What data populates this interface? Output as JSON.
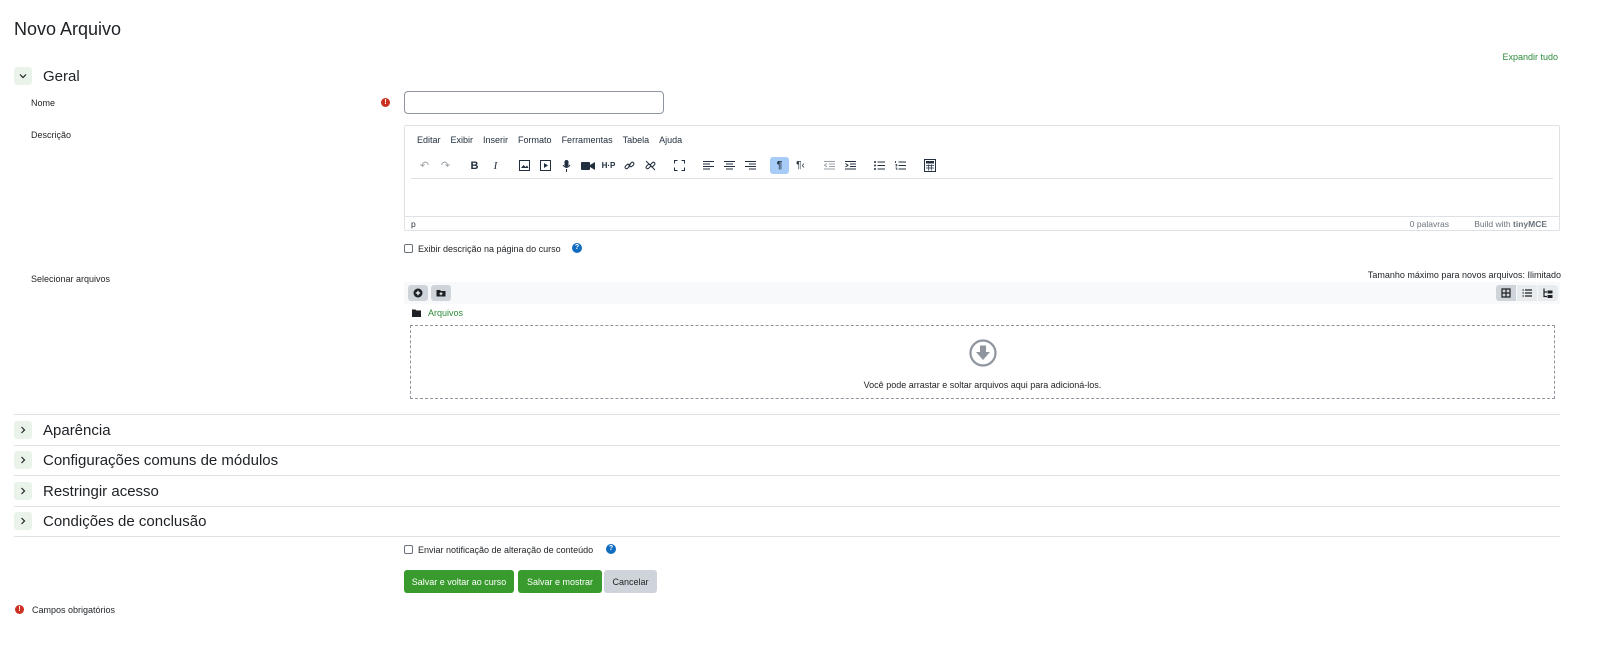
{
  "page": {
    "title": "Novo Arquivo",
    "expand_all": "Expandir tudo"
  },
  "sections": {
    "geral": "Geral",
    "aparencia": "Aparência",
    "config": "Configurações comuns de módulos",
    "restringir": "Restringir acesso",
    "conclusao": "Condições de conclusão"
  },
  "fields": {
    "nome_label": "Nome",
    "nome_value": "",
    "descricao_label": "Descrição",
    "exibir_descricao": "Exibir descrição na página do curso",
    "selecionar_label": "Selecionar arquivos",
    "max_size": "Tamanho máximo para novos arquivos: Ilimitado",
    "notificacao": "Enviar notificação de alteração de conteúdo"
  },
  "editor": {
    "menu": [
      "Editar",
      "Exibir",
      "Inserir",
      "Formato",
      "Ferramentas",
      "Tabela",
      "Ajuda"
    ],
    "status_path": "p",
    "word_count": "0 palavras",
    "build_with": "Build with",
    "brand": "tinyMCE"
  },
  "filepicker": {
    "folder": "Arquivos",
    "drop_message": "Você pode arrastar e soltar arquivos aqui para adicioná-los."
  },
  "buttons": {
    "save_return": "Salvar e voltar ao curso",
    "save_show": "Salvar e mostrar",
    "cancel": "Cancelar"
  },
  "footer": {
    "required": "Campos obrigatórios"
  },
  "colors": {
    "accent": "#399b2e",
    "link": "#2e8b3a",
    "required": "#ca3120",
    "help": "#0f6cbf"
  }
}
